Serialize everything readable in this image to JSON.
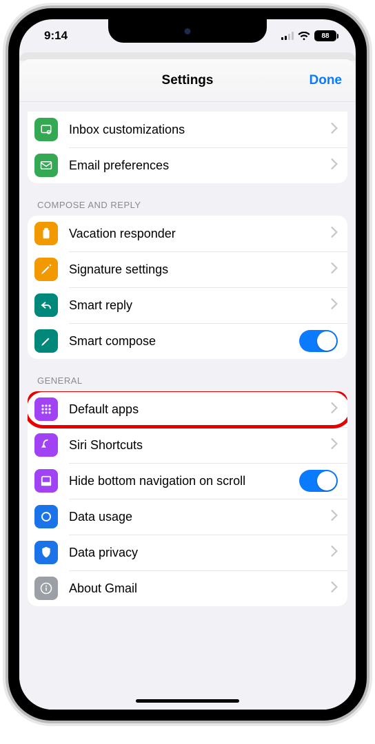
{
  "status": {
    "time": "9:14",
    "battery": "88"
  },
  "nav": {
    "title": "Settings",
    "done": "Done"
  },
  "sections": {
    "top": [
      {
        "label": "Inbox customizations"
      },
      {
        "label": "Email preferences"
      }
    ],
    "compose_header": "COMPOSE AND REPLY",
    "compose": [
      {
        "label": "Vacation responder"
      },
      {
        "label": "Signature settings"
      },
      {
        "label": "Smart reply"
      },
      {
        "label": "Smart compose"
      }
    ],
    "general_header": "GENERAL",
    "general": [
      {
        "label": "Default apps"
      },
      {
        "label": "Siri Shortcuts"
      },
      {
        "label": "Hide bottom navigation on scroll"
      },
      {
        "label": "Data usage"
      },
      {
        "label": "Data privacy"
      },
      {
        "label": "About Gmail"
      }
    ]
  },
  "highlighted_row": "default-apps",
  "colors": {
    "accent_blue": "#0a7aff",
    "highlight_red": "#e60000"
  }
}
